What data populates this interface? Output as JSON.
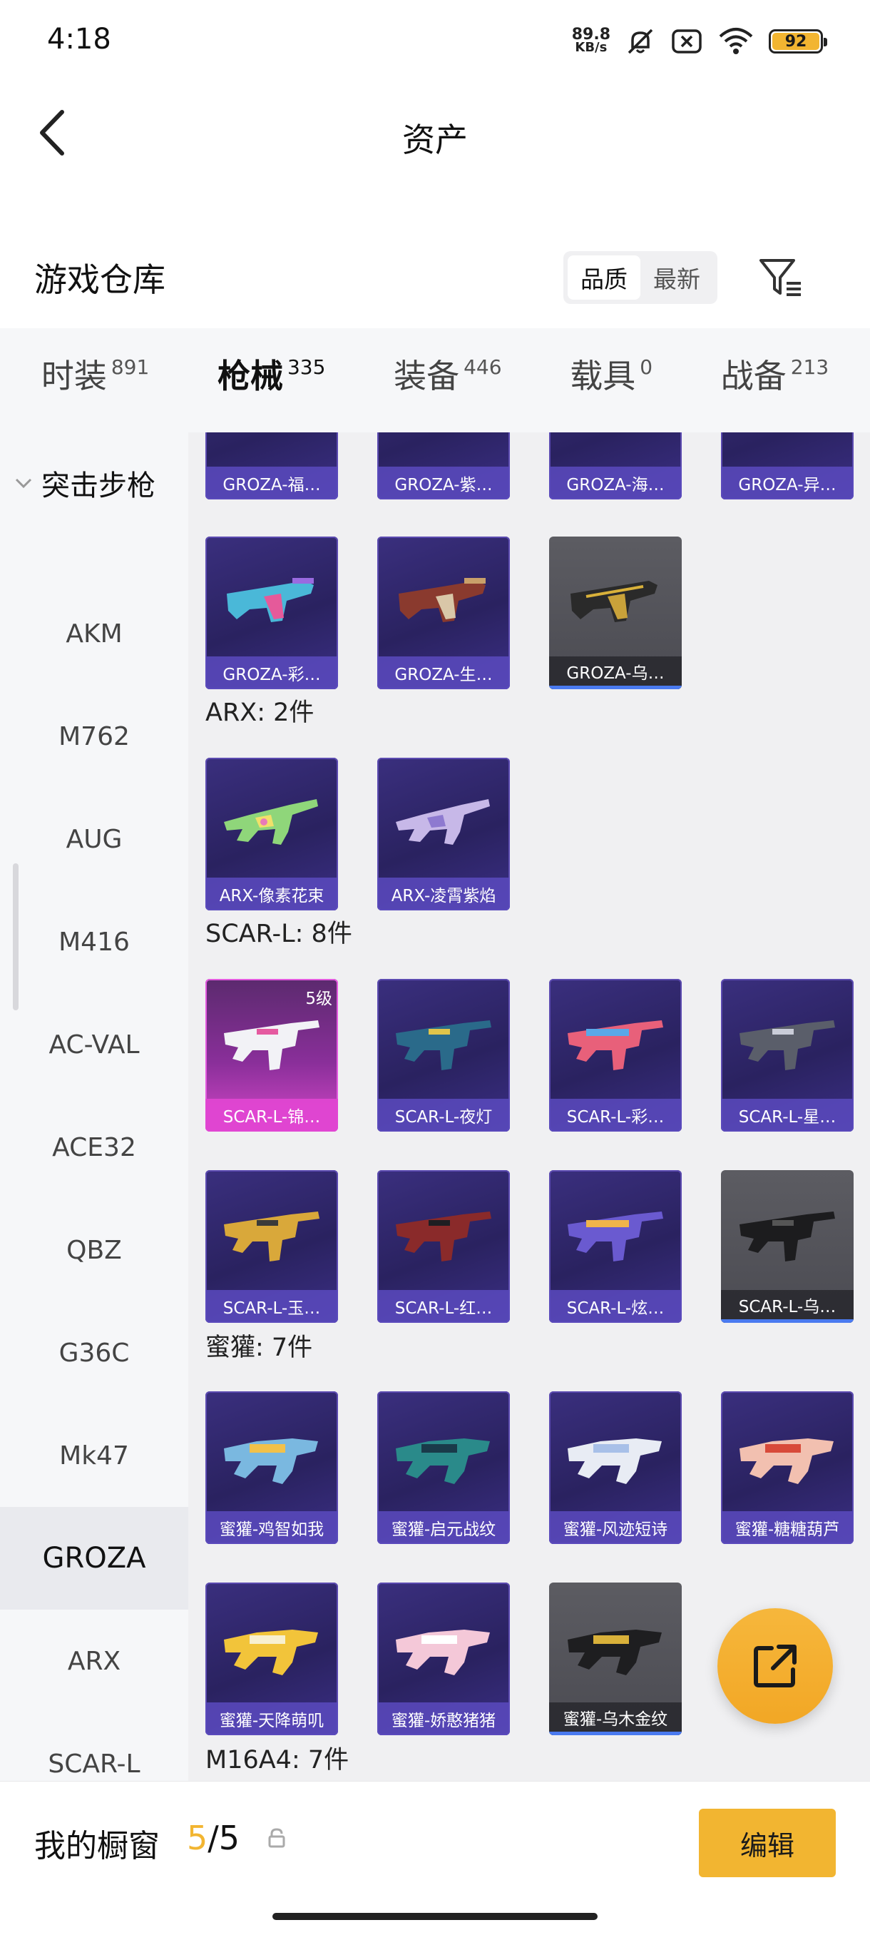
{
  "status_bar": {
    "time": "4:18",
    "net_speed_value": "89.8",
    "net_speed_unit": "KB/s",
    "battery": "92"
  },
  "header": {
    "title": "资产"
  },
  "warehouse": {
    "title": "游戏仓库",
    "sort_options": [
      "品质",
      "最新"
    ],
    "sort_selected": "品质"
  },
  "tabs": [
    {
      "label": "时装",
      "count": "891"
    },
    {
      "label": "枪械",
      "count": "335",
      "active": true
    },
    {
      "label": "装备",
      "count": "446"
    },
    {
      "label": "载具",
      "count": "0"
    },
    {
      "label": "战备",
      "count": "213"
    }
  ],
  "sidebar": {
    "group": "突击步枪",
    "items": [
      "AKM",
      "M762",
      "AUG",
      "M416",
      "AC-VAL",
      "ACE32",
      "QBZ",
      "G36C",
      "Mk47",
      "GROZA",
      "ARX",
      "SCAR-L"
    ],
    "active": "GROZA"
  },
  "content": {
    "groza_top_row": [
      "GROZA-福…",
      "GROZA-紫…",
      "GROZA-海…",
      "GROZA-异…"
    ],
    "groza_second_row": [
      "GROZA-彩…",
      "GROZA-生…",
      "GROZA-乌…"
    ],
    "arx": {
      "title": "ARX: 2件",
      "items": [
        "ARX-像素花束",
        "ARX-凌霄紫焰"
      ]
    },
    "scar": {
      "title": "SCAR-L: 8件",
      "row1": [
        "SCAR-L-锦…",
        "SCAR-L-夜灯",
        "SCAR-L-彩…",
        "SCAR-L-星…"
      ],
      "row2": [
        "SCAR-L-玉…",
        "SCAR-L-红…",
        "SCAR-L-炫…",
        "SCAR-L-乌…"
      ],
      "first_level": "5级"
    },
    "honeybadger": {
      "title": "蜜獾: 7件",
      "row1": [
        "蜜獾-鸡智如我",
        "蜜獾-启元战纹",
        "蜜獾-风迹短诗",
        "蜜獾-糖糖葫芦"
      ],
      "row2": [
        "蜜獾-天降萌叽",
        "蜜獾-娇憨猪猪",
        "蜜獾-乌木金纹"
      ]
    },
    "m16": {
      "title": "M16A4: 7件"
    }
  },
  "bottom": {
    "title": "我的橱窗",
    "count_current": "5",
    "count_sep": "/",
    "count_total": "5",
    "edit_label": "编辑"
  },
  "colors": {
    "accent": "#f2b531",
    "card_purple": "#2f2670",
    "card_gray": "#55555b",
    "card_pink": "#d648c8"
  }
}
